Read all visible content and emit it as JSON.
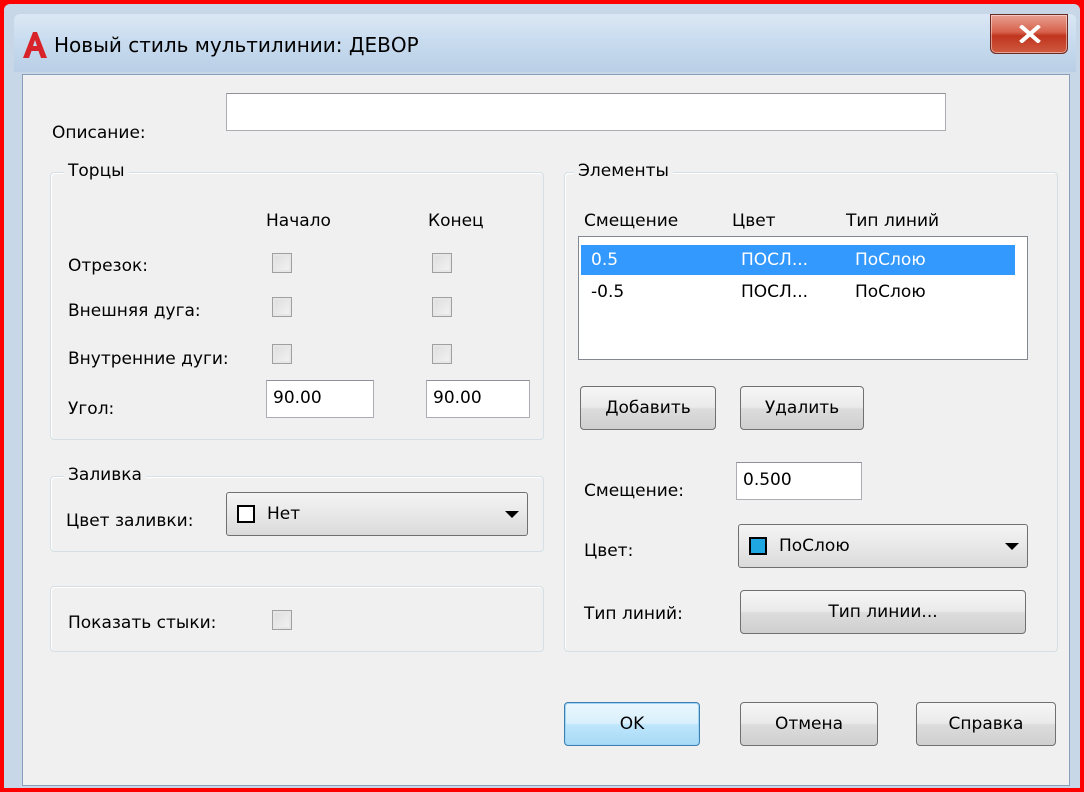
{
  "window": {
    "title": "Новый стиль мультилинии: ДЕВОР",
    "app_icon": "autocad-a-icon",
    "close_icon": "close-x-icon"
  },
  "description": {
    "label": "Описание:",
    "value": ""
  },
  "caps": {
    "title": "Торцы",
    "col_start": "Начало",
    "col_end": "Конец",
    "rows": [
      {
        "label": "Отрезок:",
        "start_checked": false,
        "end_checked": false
      },
      {
        "label": "Внешняя дуга:",
        "start_checked": false,
        "end_checked": false
      },
      {
        "label": "Внутренние дуги:",
        "start_checked": false,
        "end_checked": false
      }
    ],
    "angle_label": "Угол:",
    "angle_start": "90.00",
    "angle_end": "90.00"
  },
  "fill": {
    "title": "Заливка",
    "label": "Цвет заливки:",
    "value": "Нет",
    "swatch_color": "#ffffff"
  },
  "joints": {
    "label": "Показать стыки:",
    "checked": false
  },
  "elements": {
    "title": "Элементы",
    "headers": [
      "Смещение",
      "Цвет",
      "Тип линий"
    ],
    "rows": [
      {
        "offset": "0.5",
        "color": "ПОСЛ...",
        "linetype": "ПоСлою",
        "selected": true
      },
      {
        "offset": "-0.5",
        "color": "ПОСЛ...",
        "linetype": "ПоСлою",
        "selected": false
      }
    ],
    "add_button": "Добавить",
    "delete_button": "Удалить",
    "offset_label": "Смещение:",
    "offset_value": "0.500",
    "color_label": "Цвет:",
    "color_value": "ПоСлою",
    "color_swatch": "#1ea7e1",
    "linetype_label": "Тип линий:",
    "linetype_button": "Тип линии..."
  },
  "buttons": {
    "ok": "OK",
    "cancel": "Отмена",
    "help": "Справка"
  },
  "colors": {
    "selection": "#3399ff",
    "frame": "#ff0000",
    "dialog_bg": "#f0f0f0"
  }
}
